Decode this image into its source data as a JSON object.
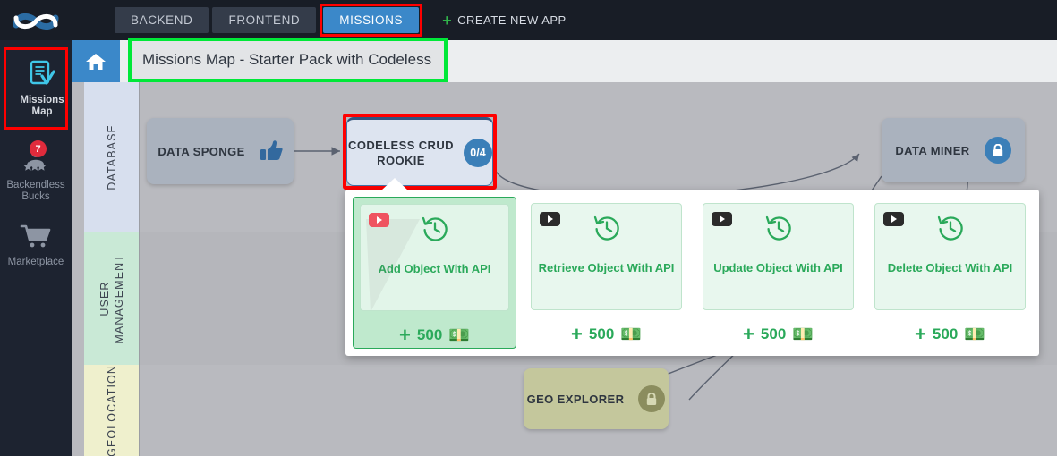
{
  "header": {
    "logo_icon": "backendless-infinity-logo",
    "tabs": [
      {
        "label": "BACKEND",
        "active": false,
        "highlighted": false
      },
      {
        "label": "FRONTEND",
        "active": false,
        "highlighted": false
      },
      {
        "label": "MISSIONS",
        "active": true,
        "highlighted": true
      }
    ],
    "create_app_label": "CREATE NEW APP",
    "create_app_icon": "plus-icon",
    "accent_blue": "#3b88c9",
    "highlight_red": "#ff0000"
  },
  "sidebar": {
    "items": [
      {
        "label": "Missions\nMap",
        "icon": "missions-map-icon",
        "highlighted": true,
        "badge": null
      },
      {
        "label": "Backendless\nBucks",
        "icon": "backendless-bucks-icon",
        "highlighted": false,
        "badge": "7"
      },
      {
        "label": "Marketplace",
        "icon": "marketplace-cart-icon",
        "highlighted": false,
        "badge": null
      }
    ],
    "badge_color": "#e02b3c"
  },
  "titlebar": {
    "home_icon": "home-icon",
    "title": "Missions Map - Starter Pack with Codeless",
    "highlight_color": "#00e838"
  },
  "map": {
    "lanes": [
      {
        "label": "DATABASE",
        "color": "#d7dfee"
      },
      {
        "label": "USER\nMANAGEMENT",
        "color": "#c9e9d6"
      },
      {
        "label": "GEOLOCATION",
        "color": "#eff0cd"
      }
    ],
    "nodes": [
      {
        "name": "DATA SPONGE",
        "state": "completed",
        "badge_type": "thumbs-up",
        "badge_text": "",
        "highlighted": false
      },
      {
        "name": "CODELESS CRUD ROOKIE",
        "state": "open",
        "badge_type": "progress",
        "badge_text": "0/4",
        "highlighted": true
      },
      {
        "name": "DATA MINER",
        "state": "locked",
        "badge_type": "lock",
        "badge_text": "",
        "highlighted": false
      },
      {
        "name": "GEO EXPLORER",
        "state": "locked",
        "badge_type": "lock-olive",
        "badge_text": "",
        "highlighted": false
      }
    ]
  },
  "popup": {
    "tasks": [
      {
        "title": "Add Object With API",
        "reward": "500",
        "video_icon": "youtube-play-icon",
        "history_icon": "clock-history-icon",
        "hovered": true
      },
      {
        "title": "Retrieve Object With API",
        "reward": "500",
        "video_icon": "youtube-play-icon",
        "history_icon": "clock-history-icon",
        "hovered": false
      },
      {
        "title": "Update Object With API",
        "reward": "500",
        "video_icon": "youtube-play-icon",
        "history_icon": "clock-history-icon",
        "hovered": false
      },
      {
        "title": "Delete Object With API",
        "reward": "500",
        "video_icon": "youtube-play-icon",
        "history_icon": "clock-history-icon",
        "hovered": false
      }
    ],
    "reward_plus": "+",
    "money_glyph": "💵",
    "green": "#2aa95a"
  }
}
